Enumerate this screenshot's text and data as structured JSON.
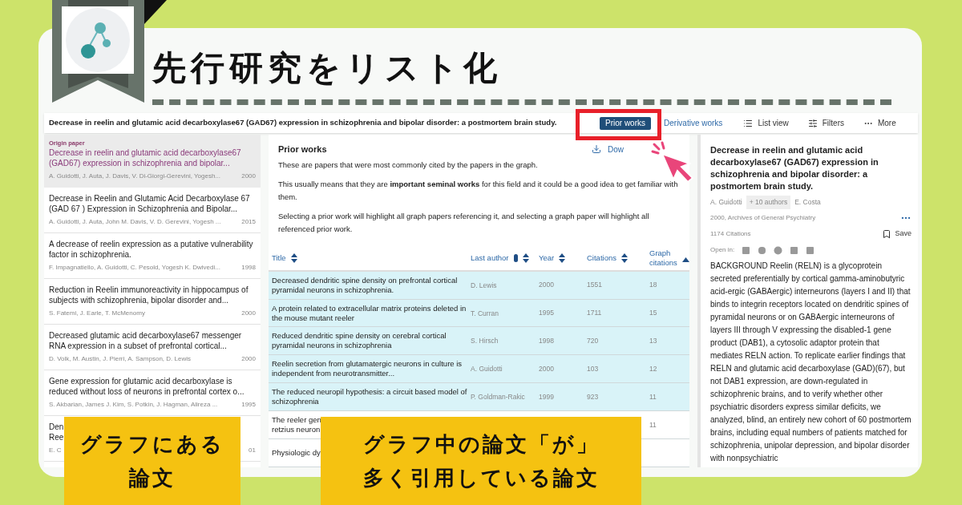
{
  "banner": {
    "title": "先行研究をリスト化"
  },
  "app": {
    "paper_title": "Decrease in reelin and glutamic acid decarboxylase67 (GAD67) expression in schizophrenia and bipolar disorder: a postmortem brain study.",
    "toolbar": [
      {
        "kind": "tab",
        "label": "Prior works",
        "selected": true
      },
      {
        "kind": "tab",
        "label": "Derivative works",
        "selected": false
      },
      {
        "kind": "list",
        "label": "List view"
      },
      {
        "kind": "filters",
        "label": "Filters"
      },
      {
        "kind": "more",
        "label": "More"
      }
    ],
    "papers": [
      {
        "tag": "Origin paper",
        "title": "Decrease in reelin and glutamic acid decarboxylase67 (GAD67) expression in schizophrenia and bipolar...",
        "authors": "A. Guidotti, J. Auta, J. Davis, V. Di-Giorgi-Gerevini, Yogesh...",
        "year": "2000",
        "selected": true
      },
      {
        "title": "Decrease in Reelin and Glutamic Acid Decarboxylase 67 (GAD 67 ) Expression in Schizophrenia and Bipolar...",
        "authors": "A. Guidotti, J. Auta, John M. Davis, V. D. Gerevini, Yogesh ...",
        "year": "2015",
        "selected": false
      },
      {
        "title": "A decrease of reelin expression as a putative vulnerability factor in schizophrenia.",
        "authors": "F. Impagnatiello, A. Guidotti, C. Pesold, Yogesh K. Dwivedi...",
        "year": "1998",
        "selected": false
      },
      {
        "title": "Reduction in Reelin immunoreactivity in hippocampus of subjects with schizophrenia, bipolar disorder and...",
        "authors": "S. Fatemi, J. Earle, T. McMenomy",
        "year": "2000",
        "selected": false
      },
      {
        "title": "Decreased glutamic acid decarboxylase67 messenger RNA expression in a subset of prefrontal cortical...",
        "authors": "D. Volk, M. Austin, J. Pierri, A. Sampson, D. Lewis",
        "year": "2000",
        "selected": false
      },
      {
        "title": "Gene expression for glutamic acid decarboxylase is reduced without loss of neurons in prefrontal cortex o...",
        "authors": "S. Akbarian, James J. Kim, S. Potkin, J. Hagman, Alireza ...",
        "year": "1995",
        "selected": false
      },
      {
        "title_lines": [
          "Den",
          "Ree"
        ],
        "authors": "E. C",
        "year": "01",
        "selected": false
      }
    ],
    "prior": {
      "heading": "Prior works",
      "download": "Dow",
      "paragraphs": [
        "These are papers that were most commonly cited by the papers in the graph.",
        "This usually means that they are **important seminal works** for this field and it could be a good idea to get familiar with them.",
        "Selecting a prior work will highlight all graph papers referencing it, and selecting a graph paper will highlight all referenced prior work."
      ],
      "columns": [
        {
          "label": "Title",
          "sorted": false
        },
        {
          "label": "Last author",
          "sorted": false,
          "info": true
        },
        {
          "label": "Year",
          "sorted": false
        },
        {
          "label": "Citations",
          "sorted": false
        },
        {
          "label": "Graph citations",
          "sorted": true
        }
      ],
      "rows": [
        {
          "title": "Decreased dendritic spine density on prefrontal cortical pyramidal neurons in schizophrenia.",
          "author": "D. Lewis",
          "year": "2000",
          "citations": "1551",
          "graph": "18",
          "highlighted": true
        },
        {
          "title": "A protein related to extracellular matrix proteins deleted in the mouse mutant reeler",
          "author": "T. Curran",
          "year": "1995",
          "citations": "1711",
          "graph": "15",
          "highlighted": true
        },
        {
          "title": "Reduced dendritic spine density on cerebral cortical pyramidal neurons in schizophrenia",
          "author": "S. Hirsch",
          "year": "1998",
          "citations": "720",
          "graph": "13",
          "highlighted": true
        },
        {
          "title": "Reelin secretion from glutamatergic neurons in culture is independent from neurotransmitter...",
          "author": "A. Guidotti",
          "year": "2000",
          "citations": "103",
          "graph": "12",
          "highlighted": true
        },
        {
          "title": "The reduced neuropil hypothesis: a circuit based model of schizophrenia",
          "author": "P. Goldman-Rakic",
          "year": "1999",
          "citations": "923",
          "graph": "11",
          "highlighted": true
        },
        {
          "title_lines": [
            "The reeler gen",
            "retzius neuron"
          ],
          "graph": "11",
          "highlighted": false
        },
        {
          "title_lines": [
            "Physiologic dy"
          ],
          "highlighted": false
        }
      ]
    },
    "detail": {
      "title": "Decrease in reelin and glutamic acid decarboxylase67 (GAD67) expression in schizophrenia and bipolar disorder: a postmortem brain study.",
      "first_author": "A. Guidotti",
      "more_authors": "+ 10 authors",
      "last_author": "E. Costa",
      "meta": "2000, Archives of General Psychiatry",
      "citations": "1174 Citations",
      "save": "Save",
      "open_in": "Open in:",
      "abstract": "BACKGROUND Reelin (RELN) is a glycoprotein secreted preferentially by cortical gamma-aminobutyric acid-ergic (GABAergic) interneurons (layers I and II) that binds to integrin receptors located on dendritic spines of pyramidal neurons or on GABAergic interneurons of layers III through V expressing the disabled-1 gene product (DAB1), a cytosolic adaptor protein that mediates RELN action. To replicate earlier findings that RELN and glutamic acid decarboxylase (GAD)(67), but not DAB1 expression, are down-regulated in schizophrenic brains, and to verify whether other psychiatric disorders express similar deficits, we analyzed, blind, an entirely new cohort of 60 postmortem brains, including equal numbers of patients matched for schizophrenia, unipolar depression, and bipolar disorder with nonpsychiatric"
    }
  },
  "callouts": [
    {
      "lines": [
        "グラフにある",
        "論文"
      ]
    },
    {
      "lines": [
        "グラフ中の論文「が」",
        "多く引用している論文"
      ]
    }
  ]
}
